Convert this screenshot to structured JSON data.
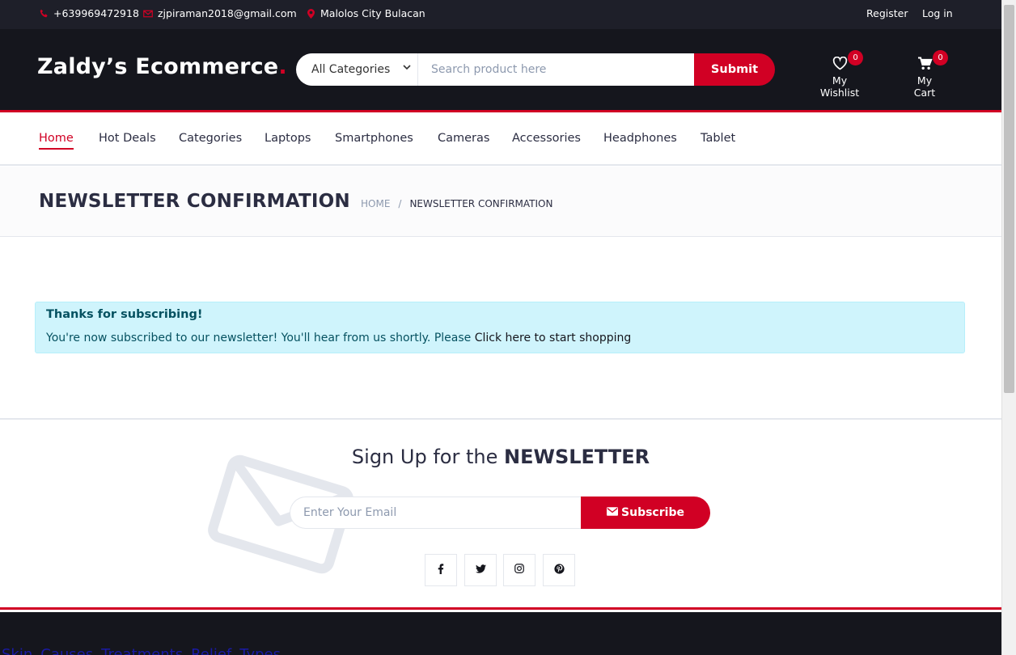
{
  "topbar": {
    "phone": "+639969472918",
    "email": "zjpiraman2018@gmail.com",
    "location": "Malolos City Bulacan",
    "register": "Register",
    "login": "Log in"
  },
  "header": {
    "logo_text": "Zaldy’s Ecommerce",
    "logo_dot": ".",
    "category_select": "All Categories",
    "search_placeholder": "Search product here",
    "submit_label": "Submit",
    "wishlist_label": "My Wishlist",
    "wishlist_count": "0",
    "cart_label": "My Cart",
    "cart_count": "0"
  },
  "nav": {
    "items": [
      {
        "label": "Home",
        "active": true
      },
      {
        "label": "Hot Deals"
      },
      {
        "label": "Categories"
      },
      {
        "label": "Laptops"
      },
      {
        "label": "Smartphones"
      },
      {
        "label": "Cameras"
      },
      {
        "label": "Accessories"
      },
      {
        "label": "Headphones"
      },
      {
        "label": "Tablet"
      }
    ]
  },
  "breadcrumb": {
    "title": "NEWSLETTER CONFIRMATION",
    "home": "HOME",
    "separator": "/",
    "current": "NEWSLETTER CONFIRMATION"
  },
  "alert": {
    "heading": "Thanks for subscribing!",
    "message": "You're now subscribed to our newsletter! You'll hear from us shortly. Please ",
    "link": "Click here to start shopping"
  },
  "newsletter": {
    "headline_prefix": "Sign Up for the ",
    "headline_bold": "NEWSLETTER",
    "email_placeholder": "Enter Your Email",
    "subscribe_label": "Subscribe",
    "social": [
      "facebook-icon",
      "twitter-icon",
      "instagram-icon",
      "pinterest-icon"
    ]
  },
  "footer": {
    "links": [
      "Skin",
      "Causes",
      "Treatments",
      "Relief",
      "Types"
    ]
  },
  "colors": {
    "accent": "#d10024",
    "dark": "#15161d",
    "topbar": "#1e1f29",
    "alert_bg": "#cff4fc"
  }
}
